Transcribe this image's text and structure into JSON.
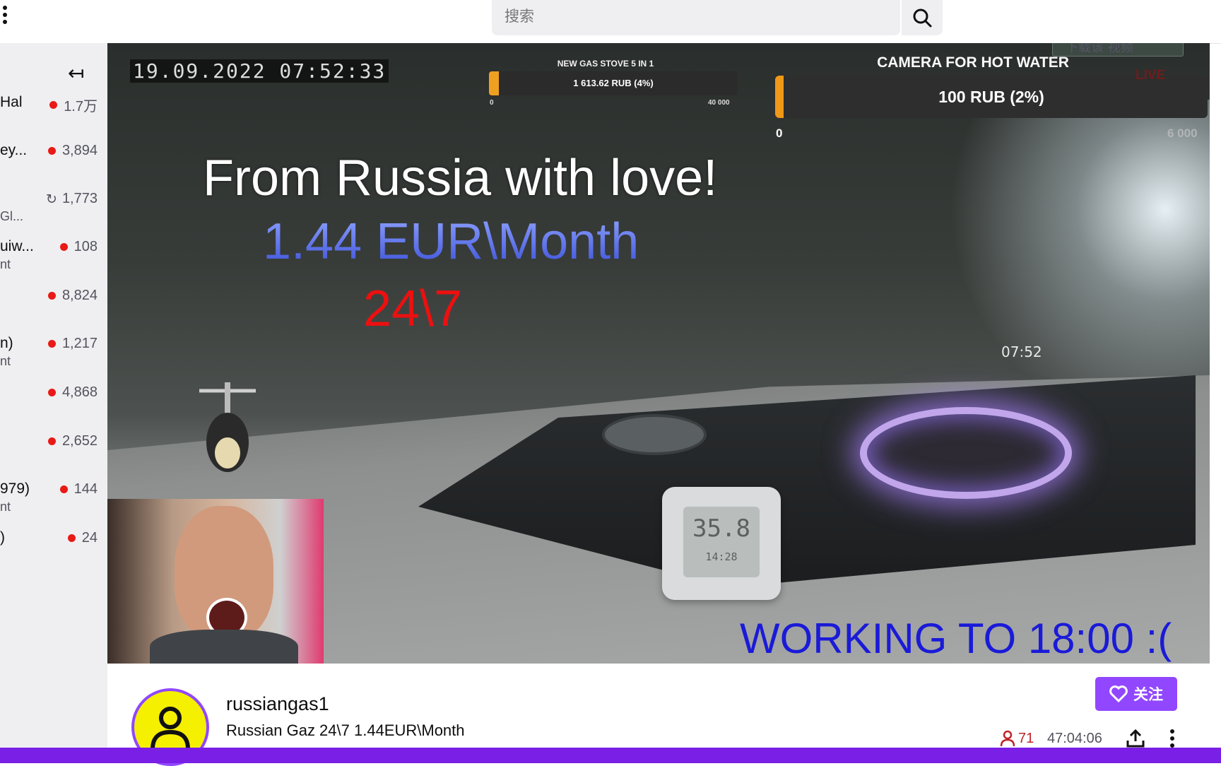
{
  "search": {
    "placeholder": "搜索"
  },
  "sidebar": {
    "collapse_glyph": "↤",
    "channels": [
      {
        "name": "Hal",
        "subtitle": "",
        "viewers": "1.7万",
        "live": true
      },
      {
        "name": "ey...",
        "subtitle": "",
        "viewers": "3,894",
        "live": true
      },
      {
        "name": "",
        "subtitle": "Gl...",
        "viewers": "1,773",
        "live": false,
        "rerun": true
      },
      {
        "name": "uiw...",
        "subtitle": "nt",
        "viewers": "108",
        "live": true
      },
      {
        "name": "",
        "subtitle": "",
        "viewers": "8,824",
        "live": true
      },
      {
        "name": "n)",
        "subtitle": "nt",
        "viewers": "1,217",
        "live": true
      },
      {
        "name": "",
        "subtitle": "",
        "viewers": "4,868",
        "live": true
      },
      {
        "name": "",
        "subtitle": "",
        "viewers": "2,652",
        "live": true
      },
      {
        "name": "979)",
        "subtitle": "nt",
        "viewers": "144",
        "live": true
      },
      {
        "name": ")",
        "subtitle": "",
        "viewers": "24",
        "live": true
      }
    ]
  },
  "video": {
    "timestamp": "19.09.2022 07:52:33",
    "goal_small": {
      "title": "NEW GAS STOVE 5 IN 1",
      "text": "1 613.62 RUB (4%)",
      "min": "0",
      "max": "40 000",
      "progress": 0.04
    },
    "goal_camera": {
      "title": "CAMERA FOR HOT WATER",
      "text": "100 RUB (2%)",
      "min": "0",
      "max": "6 000",
      "progress": 0.02
    },
    "download_overlay": "下载该 视频",
    "live_tag": "LIVE",
    "line1": "From Russia with love!",
    "line2": "1.44 EUR\\Month",
    "line3": "24\\7",
    "working": "WORKING TO 18:00 :(",
    "stove_clock": "07:52",
    "thermometer_temp": "35.8",
    "thermometer_sub": "14:28"
  },
  "stream_info": {
    "streamer": "russiangas1",
    "title": "Russian Gaz 24\\7 1.44EUR\\Month",
    "follow_label": "关注",
    "viewers": "71",
    "uptime": "47:04:06"
  },
  "colors": {
    "accent": "#9147ff",
    "live_red": "#e91916",
    "working_text": "#1a1ad8",
    "red_text": "#ec1010"
  }
}
